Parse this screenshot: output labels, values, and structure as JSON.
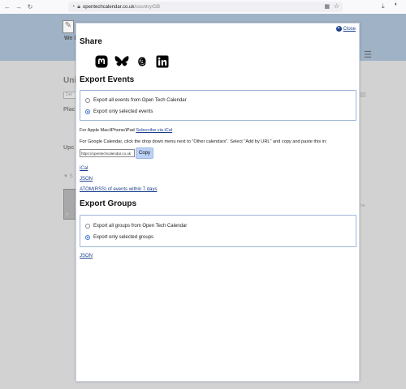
{
  "browser": {
    "back_icon": "arrow-left-icon",
    "forward_icon": "arrow-right-icon",
    "reload_icon": "reload-icon",
    "url_host": "opentechcalendar.co.uk",
    "url_path": "/country/GB"
  },
  "background": {
    "site_tagline": "We l",
    "heading": "Uni",
    "tab_label": "Det",
    "right_link": "port",
    "places_label": "Plac",
    "upcoming_label": "Upc",
    "filter_label": "S",
    "card_label": "7",
    "side_text": "ne."
  },
  "modal": {
    "close_label": "Close",
    "share_heading": "Share",
    "social": [
      {
        "name": "mastodon-icon",
        "color": "#000000"
      },
      {
        "name": "bluesky-icon",
        "color": "#000000"
      },
      {
        "name": "threads-icon",
        "color": "#000000"
      },
      {
        "name": "linkedin-icon",
        "color": "#000000"
      }
    ],
    "export_events": {
      "heading": "Export Events",
      "options": [
        {
          "label": "Export all events from Open Tech Calendar",
          "selected": false
        },
        {
          "label": "Export only selected events",
          "selected": true
        }
      ],
      "apple_text": "For Apple Mac/iPhone/iPad",
      "apple_link": "Subscribe via iCal",
      "google_text": "For Google Calendar, click the drop down menu next to \"Other calendars\". Select \"Add by URL\" and copy and paste this in:",
      "url_value": "https://opentechcalendar.co.uk",
      "copy_label": "Copy",
      "links": [
        "iCal",
        "JSON",
        "ATOM(RSS) of events within 7 days"
      ]
    },
    "export_groups": {
      "heading": "Export Groups",
      "options": [
        {
          "label": "Export all groups from Open Tech Calendar",
          "selected": false
        },
        {
          "label": "Export only selected groups",
          "selected": true
        }
      ],
      "links": [
        "JSON"
      ]
    }
  },
  "colors": {
    "link": "#1a3e8c",
    "accent": "#3b73d3",
    "copy_button": "#bcd2f6",
    "overlay_banner": "#9fb2c6"
  }
}
